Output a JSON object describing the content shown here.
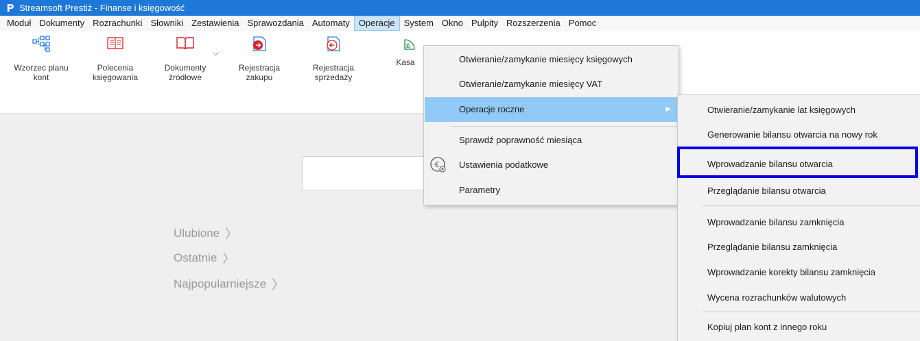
{
  "window": {
    "title": "Streamsoft Prestiż - Finanse i księgowość",
    "logo_letter": "P"
  },
  "menubar": {
    "items": [
      {
        "label": "Moduł"
      },
      {
        "label": "Dokumenty"
      },
      {
        "label": "Rozrachunki"
      },
      {
        "label": "Słowniki"
      },
      {
        "label": "Zestawienia"
      },
      {
        "label": "Sprawozdania"
      },
      {
        "label": "Automaty"
      },
      {
        "label": "Operacje"
      },
      {
        "label": "System"
      },
      {
        "label": "Okno"
      },
      {
        "label": "Pulpity"
      },
      {
        "label": "Rozszerzenia"
      },
      {
        "label": "Pomoc"
      }
    ],
    "active_index": 7
  },
  "ribbon": {
    "buttons": [
      {
        "line1": "Wzorzec planu",
        "line2": "kont",
        "icon": "chart-of-accounts-icon"
      },
      {
        "line1": "Polecenia",
        "line2": "księgowania",
        "icon": "booking-order-icon"
      },
      {
        "line1": "Dokumenty",
        "line2": "źródłowe",
        "icon": "book-icon"
      },
      {
        "line1": "Rejestracja",
        "line2": "zakupu",
        "icon": "purchase-register-icon"
      },
      {
        "line1": "Rejestracja",
        "line2": "sprzedaży",
        "icon": "sales-register-icon"
      },
      {
        "line1": "Kasa",
        "line2": "",
        "icon": "cash-icon"
      }
    ]
  },
  "workarea": {
    "links": [
      {
        "label": "Ulubione"
      },
      {
        "label": "Ostatnie"
      },
      {
        "label": "Najpopularniejsze"
      }
    ]
  },
  "dropdown": {
    "items": [
      {
        "label": "Otwieranie/zamykanie miesięcy księgowych"
      },
      {
        "label": "Otwieranie/zamykanie miesięcy VAT"
      },
      {
        "label": "Operacje roczne"
      },
      {
        "label": "Sprawdź poprawność miesiąca"
      },
      {
        "label": "Ustawienia podatkowe"
      },
      {
        "label": "Parametry"
      }
    ],
    "highlighted_index": 2,
    "highlight_color": "#91c9f7"
  },
  "submenu": {
    "items": [
      {
        "label": "Otwieranie/zamykanie lat księgowych"
      },
      {
        "label": "Generowanie bilansu otwarcia na nowy rok"
      },
      {
        "label": "Wprowadzanie bilansu otwarcia"
      },
      {
        "label": "Przeglądanie bilansu otwarcia"
      },
      {
        "label": "Wprowadzanie bilansu zamknięcia"
      },
      {
        "label": "Przeglądanie bilansu zamknięcia"
      },
      {
        "label": "Wprowadzanie korekty bilansu zamknięcia"
      },
      {
        "label": "Wycena rozrachunków walutowych"
      },
      {
        "label": "Kopiuj plan kont z innego roku"
      }
    ],
    "boxed_index": 2,
    "box_color": "#0000e6"
  },
  "colors": {
    "titlebar": "#1e78d7",
    "accent_red": "#d9232e",
    "accent_blue": "#2c7fd8"
  }
}
